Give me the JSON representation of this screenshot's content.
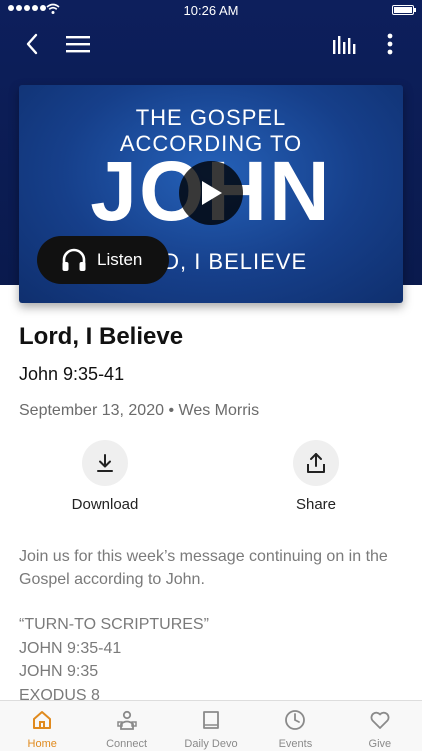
{
  "status_bar": {
    "time": "10:26 AM"
  },
  "nav": {
    "back": "back",
    "menu": "menu",
    "audio": "audio-levels",
    "more": "more"
  },
  "video": {
    "title_line1": "THE GOSPEL",
    "title_line2": "ACCORDING TO",
    "title_big": "JOHN",
    "title_sub": "LORD, I BELIEVE",
    "listen_label": "Listen"
  },
  "sermon": {
    "title": "Lord, I Believe",
    "reference": "John 9:35-41",
    "date": "September 13, 2020",
    "separator": "•",
    "speaker": "Wes Morris"
  },
  "actions": {
    "download_label": "Download",
    "share_label": "Share"
  },
  "description": "Join us for this week’s message continuing on in the Gospel according to John.",
  "scriptures": {
    "heading": "“TURN-TO SCRIPTURES”",
    "items": [
      "JOHN 9:35-41",
      "JOHN 9:35",
      "EXODUS 8"
    ]
  },
  "tabs": [
    {
      "label": "Home",
      "icon": "home-icon",
      "active": true
    },
    {
      "label": "Connect",
      "icon": "connect-icon",
      "active": false
    },
    {
      "label": "Daily Devo",
      "icon": "book-icon",
      "active": false
    },
    {
      "label": "Events",
      "icon": "clock-icon",
      "active": false
    },
    {
      "label": "Give",
      "icon": "heart-icon",
      "active": false
    }
  ],
  "colors": {
    "header_bg": "#0d1f5c",
    "accent": "#e08a1e",
    "muted_text": "#7a7a7a"
  }
}
